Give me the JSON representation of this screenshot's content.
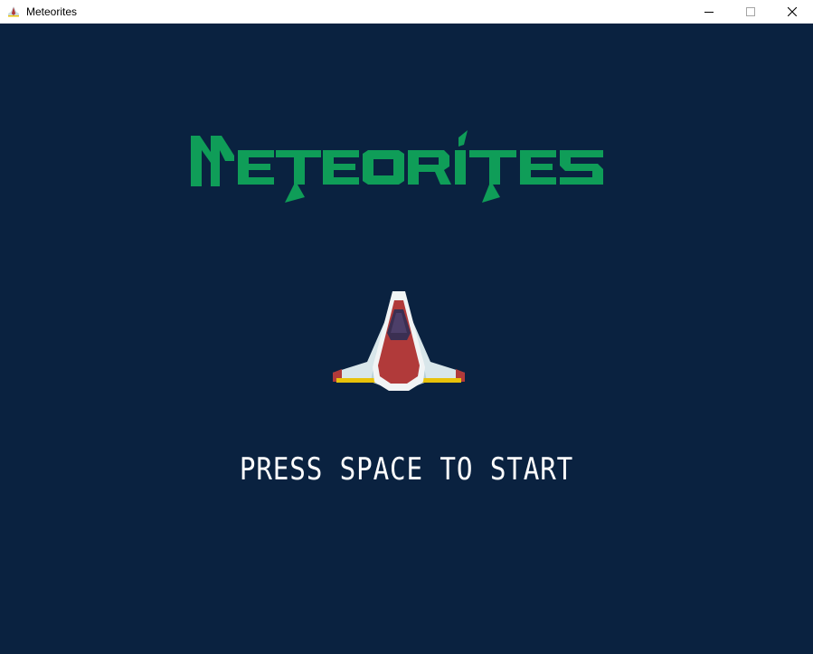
{
  "window": {
    "title": "Meteorites",
    "app_icon": "ship-icon",
    "controls": [
      "minimize-icon",
      "maximize-icon",
      "close-icon"
    ]
  },
  "game": {
    "logo_text": "METEORITES",
    "player_icon": "spaceship-icon",
    "prompt": "PRESS SPACE TO START"
  },
  "colors": {
    "background": "#0a2240",
    "logo": "#0f9d58",
    "prompt": "#ffffff",
    "ship_body": "#b13a3a",
    "ship_wing": "#d8e6ea",
    "ship_trim": "#e8c20a"
  }
}
